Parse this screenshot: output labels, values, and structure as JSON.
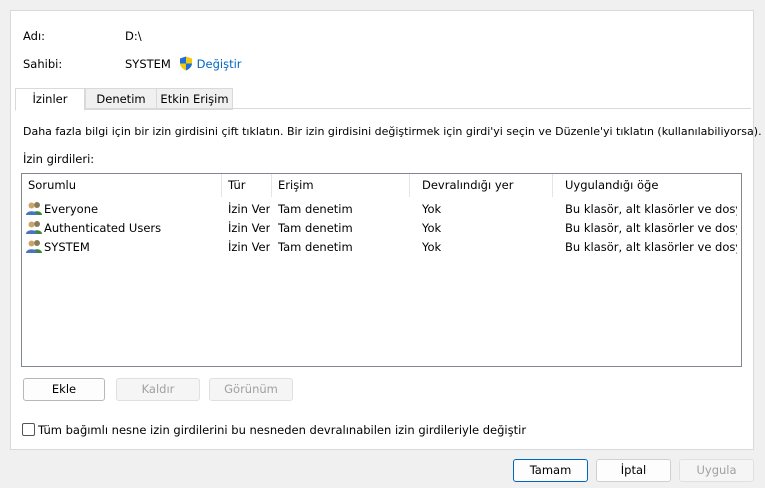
{
  "header": {
    "name_label": "Adı:",
    "name_value": "D:\\",
    "owner_label": "Sahibi:",
    "owner_value": "SYSTEM",
    "change_link": "Değiştir"
  },
  "tabs": [
    {
      "label": "İzinler",
      "active": true
    },
    {
      "label": "Denetim",
      "active": false
    },
    {
      "label": "Etkin Erişim",
      "active": false
    }
  ],
  "info_text": "Daha fazla bilgi için bir izin girdisini çift tıklatın. Bir izin girdisini değiştirmek için girdi'yi seçin ve Düzenle'yi tıklatın (kullanılabiliyorsa).",
  "entries_label": "İzin girdileri:",
  "table": {
    "columns": [
      "Sorumlu",
      "Tür",
      "Erişim",
      "Devralındığı yer",
      "Uygulandığı öğe"
    ],
    "rows": [
      {
        "principal": "Everyone",
        "type": "İzin Ver",
        "access": "Tam denetim",
        "inherited": "Yok",
        "applies": "Bu klasör, alt klasörler ve dosy..."
      },
      {
        "principal": "Authenticated Users",
        "type": "İzin Ver",
        "access": "Tam denetim",
        "inherited": "Yok",
        "applies": "Bu klasör, alt klasörler ve dosy..."
      },
      {
        "principal": "SYSTEM",
        "type": "İzin Ver",
        "access": "Tam denetim",
        "inherited": "Yok",
        "applies": "Bu klasör, alt klasörler ve dosy..."
      }
    ]
  },
  "buttons": {
    "add": "Ekle",
    "remove": "Kaldır",
    "view": "Görünüm"
  },
  "replace_checkbox": {
    "label": "Tüm bağımlı nesne izin girdilerini bu nesneden devralınabilen izin girdileriyle değiştir",
    "checked": false
  },
  "footer": {
    "ok": "Tamam",
    "cancel": "İptal",
    "apply": "Uygula"
  },
  "icons": {
    "shield": "uac-shield-icon",
    "users": "users-icon"
  },
  "colors": {
    "link": "#0067c0",
    "accent": "#0067c0"
  }
}
